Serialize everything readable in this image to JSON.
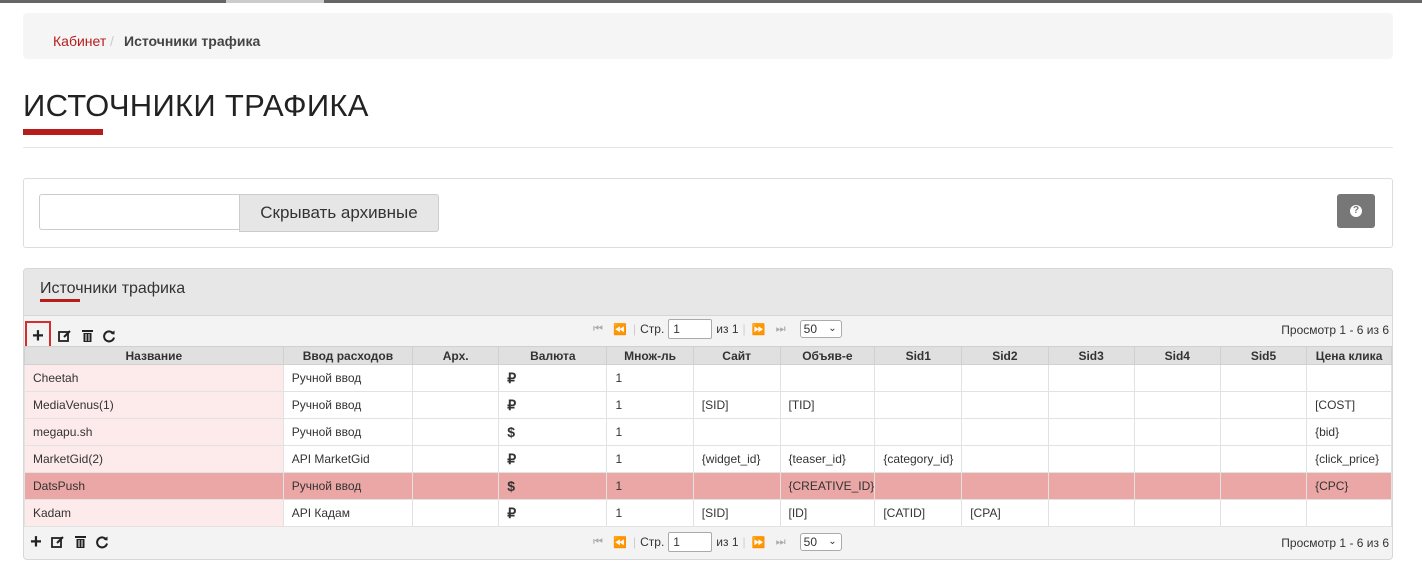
{
  "breadcrumb": {
    "home": "Кабинет",
    "separator": "/",
    "current": "Источники трафика"
  },
  "page": {
    "title": "ИСТОЧНИКИ ТРАФИКА"
  },
  "filter": {
    "input_value": "",
    "archive_button": "Скрывать архивные",
    "help_icon": "?"
  },
  "grid": {
    "caption": "Источники трафика",
    "toolbar": {
      "add": "+",
      "edit_icon": "edit-icon",
      "delete_icon": "trash-icon",
      "refresh_icon": "refresh-icon"
    },
    "pager": {
      "page_label": "Стр.",
      "page_value": "1",
      "of_label": "из 1",
      "per_page": "50",
      "view_text": "Просмотр 1 - 6 из 6"
    },
    "columns": [
      "Название",
      "Ввод расходов",
      "Арх.",
      "Валюта",
      "Множ-ль",
      "Сайт",
      "Объяв-е",
      "Sid1",
      "Sid2",
      "Sid3",
      "Sid4",
      "Sid5",
      "Цена клика"
    ],
    "rows": [
      [
        "Cheetah",
        "Ручной ввод",
        "",
        "₽",
        "1",
        "",
        "",
        "",
        "",
        "",
        "",
        "",
        ""
      ],
      [
        "MediaVenus(1)",
        "Ручной ввод",
        "",
        "₽",
        "1",
        "[SID]",
        "[TID]",
        "",
        "",
        "",
        "",
        "",
        "[COST]"
      ],
      [
        "megapu.sh",
        "Ручной ввод",
        "",
        "$",
        "1",
        "",
        "",
        "",
        "",
        "",
        "",
        "",
        "{bid}"
      ],
      [
        "MarketGid(2)",
        "API MarketGid",
        "",
        "₽",
        "1",
        "{widget_id}",
        "{teaser_id}",
        "{category_id}",
        "",
        "",
        "",
        "",
        "{click_price}"
      ],
      [
        "DatsPush",
        "Ручной ввод",
        "",
        "$",
        "1",
        "",
        "{CREATIVE_ID}",
        "",
        "",
        "",
        "",
        "",
        "{CPC}"
      ],
      [
        "Kadam",
        "API Кадам",
        "",
        "₽",
        "1",
        "[SID]",
        "[ID]",
        "[CATID]",
        "[CPA]",
        "",
        "",
        "",
        ""
      ]
    ],
    "selected_row": 4
  },
  "colors": {
    "accent": "#b71c1c",
    "selected_row": "#eaa7a5",
    "name_cell": "#fdeaea"
  }
}
